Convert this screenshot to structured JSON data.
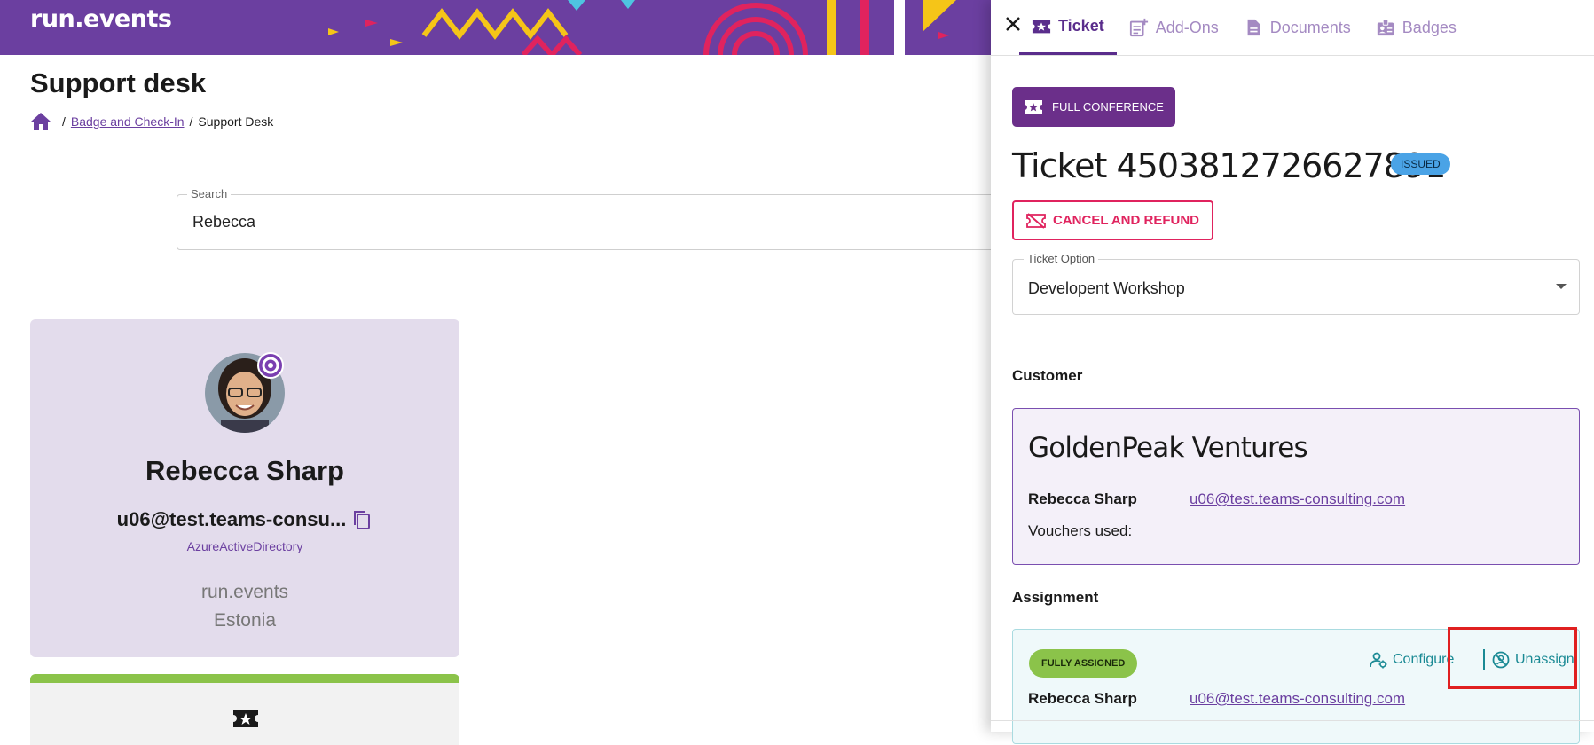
{
  "app": {
    "brand": "run.events"
  },
  "page": {
    "title": "Support desk",
    "breadcrumb": {
      "link": "Badge and Check-In",
      "separator": "/",
      "current": "Support Desk"
    }
  },
  "search": {
    "label": "Search",
    "value": "Rebecca"
  },
  "profile": {
    "name": "Rebecca Sharp",
    "email": "u06@test.teams-consu...",
    "source": "AzureActiveDirectory",
    "organization": "run.events",
    "country": "Estonia"
  },
  "panel": {
    "tabs": [
      {
        "label": "Ticket",
        "icon": "ticket-star-icon",
        "active": true
      },
      {
        "label": "Add-Ons",
        "icon": "note-add-icon",
        "active": false
      },
      {
        "label": "Documents",
        "icon": "document-icon",
        "active": false
      },
      {
        "label": "Badges",
        "icon": "badge-icon",
        "active": false
      }
    ],
    "ticket_type": "FULL CONFERENCE",
    "ticket_title": "Ticket 4503812726627891",
    "status": "ISSUED",
    "cancel_label": "CANCEL AND REFUND",
    "ticket_option": {
      "label": "Ticket Option",
      "value": "Developent Workshop"
    },
    "customer": {
      "heading": "Customer",
      "company": "GoldenPeak Ventures",
      "person": "Rebecca Sharp",
      "email": "u06@test.teams-consulting.com",
      "vouchers_label": "Vouchers used:"
    },
    "assignment": {
      "heading": "Assignment",
      "status": "FULLY ASSIGNED",
      "configure_label": "Configure",
      "unassign_label": "Unassign",
      "person": "Rebecca Sharp",
      "email": "u06@test.teams-consulting.com"
    }
  },
  "colors": {
    "brand_purple": "#6b3fa0",
    "accent_teal": "#1a8a94",
    "danger": "#e0235e",
    "success": "#8bc34a",
    "info": "#4aa3e6",
    "highlight": "#e02020"
  }
}
